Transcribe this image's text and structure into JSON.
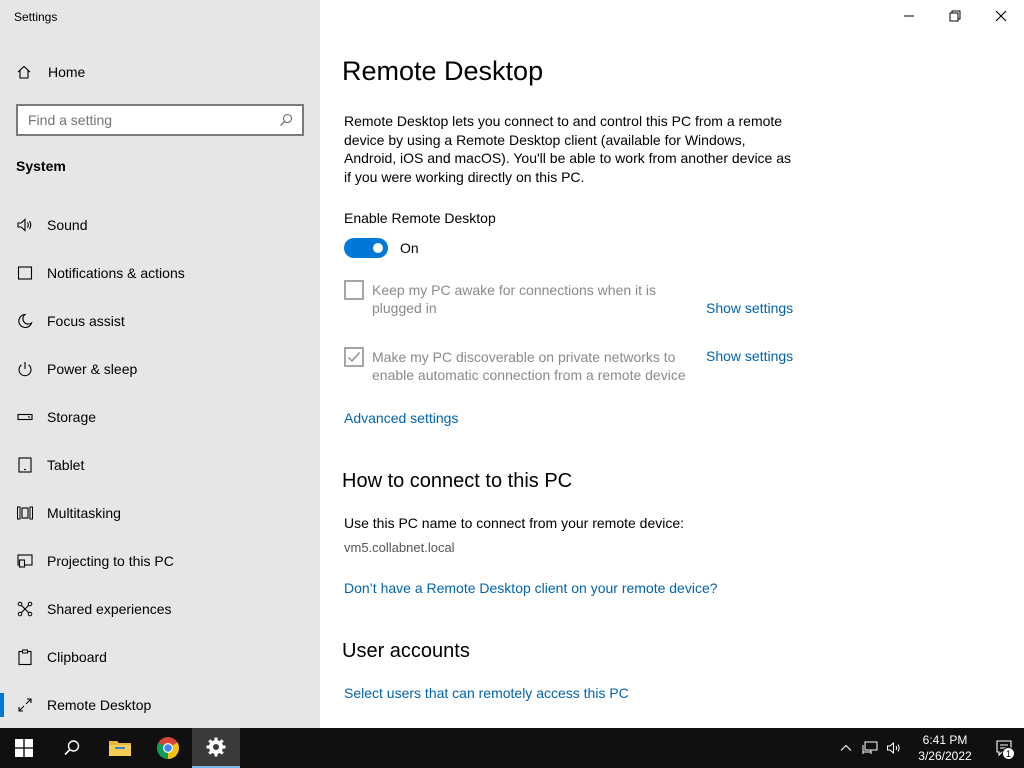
{
  "window": {
    "title": "Settings",
    "controls": [
      "minimize-icon",
      "restore-icon",
      "close-icon"
    ]
  },
  "sidebar": {
    "home_label": "Home",
    "search": {
      "placeholder": "Find a setting",
      "icon": "search-icon"
    },
    "section_title": "System",
    "items": [
      {
        "label": "Sound",
        "icon": "speaker-icon",
        "active": false
      },
      {
        "label": "Notifications & actions",
        "icon": "notification-icon",
        "active": false
      },
      {
        "label": "Focus assist",
        "icon": "moon-icon",
        "active": false
      },
      {
        "label": "Power & sleep",
        "icon": "power-icon",
        "active": false
      },
      {
        "label": "Storage",
        "icon": "storage-icon",
        "active": false
      },
      {
        "label": "Tablet",
        "icon": "tablet-icon",
        "active": false
      },
      {
        "label": "Multitasking",
        "icon": "multitasking-icon",
        "active": false
      },
      {
        "label": "Projecting to this PC",
        "icon": "projecting-icon",
        "active": false
      },
      {
        "label": "Shared experiences",
        "icon": "shared-experiences-icon",
        "active": false
      },
      {
        "label": "Clipboard",
        "icon": "clipboard-icon",
        "active": false
      },
      {
        "label": "Remote Desktop",
        "icon": "remote-desktop-icon",
        "active": true
      }
    ]
  },
  "main": {
    "title": "Remote Desktop",
    "description": "Remote Desktop lets you connect to and control this PC from a remote device by using a Remote Desktop client (available for Windows, Android, iOS and macOS). You'll be able to work from another device as if you were working directly on this PC.",
    "enable_label": "Enable Remote Desktop",
    "toggle_state": "On",
    "option_awake": {
      "text": "Keep my PC awake for connections when it is plugged in",
      "checked": false,
      "link": "Show settings"
    },
    "option_discoverable": {
      "text": "Make my PC discoverable on private networks to enable automatic connection from a remote device",
      "checked": true,
      "link": "Show settings"
    },
    "advanced_link": "Advanced settings",
    "connect_heading": "How to connect to this PC",
    "connect_text": "Use this PC name to connect from your remote device:",
    "pc_name": "vm5.collabnet.local",
    "client_link": "Don’t have a Remote Desktop client on your remote device?",
    "accounts_heading": "User accounts",
    "accounts_link": "Select users that can remotely access this PC"
  },
  "taskbar": {
    "buttons": [
      "start-icon",
      "search-icon",
      "file-explorer-icon",
      "chrome-icon",
      "settings-gear-icon"
    ],
    "tray_icons": [
      "chevron-up-icon",
      "network-icon",
      "volume-icon"
    ],
    "time": "6:41 PM",
    "date": "3/26/2022",
    "notification_count": "1",
    "colors": {
      "accent": "#0078d7",
      "link": "#0063b1",
      "taskbar": "#101010"
    }
  }
}
